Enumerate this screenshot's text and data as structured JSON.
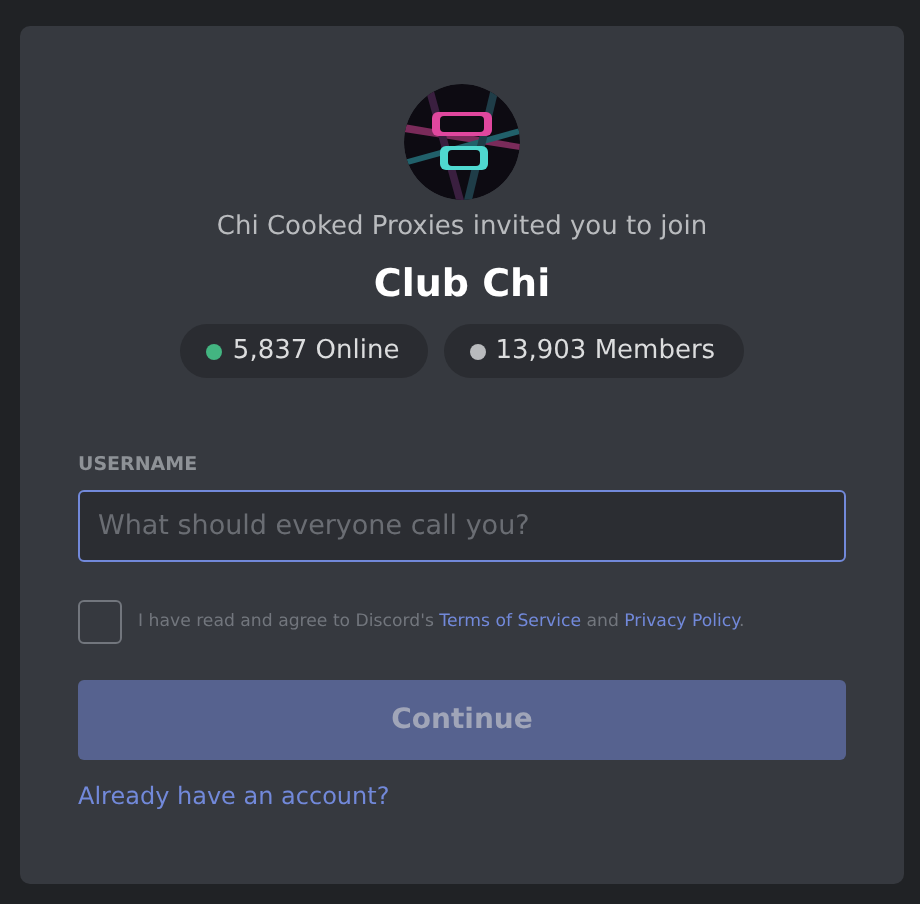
{
  "invite": {
    "inviter_text": "Chi Cooked Proxies invited you to join",
    "server_name": "Club Chi",
    "stats": [
      {
        "label": "5,837 Online",
        "color": "#43b581"
      },
      {
        "label": "13,903 Members",
        "color": "#b9bbbe"
      }
    ]
  },
  "form": {
    "username_label": "USERNAME",
    "username_placeholder": "What should everyone call you?",
    "agree": {
      "checked": false,
      "parts": [
        "I have read and agree to Discord's",
        "Terms of Service",
        "and",
        "Privacy Policy",
        "."
      ]
    },
    "continue_button": {
      "label": "Continue",
      "disabled": true
    },
    "login_link": "Already have an account?"
  }
}
